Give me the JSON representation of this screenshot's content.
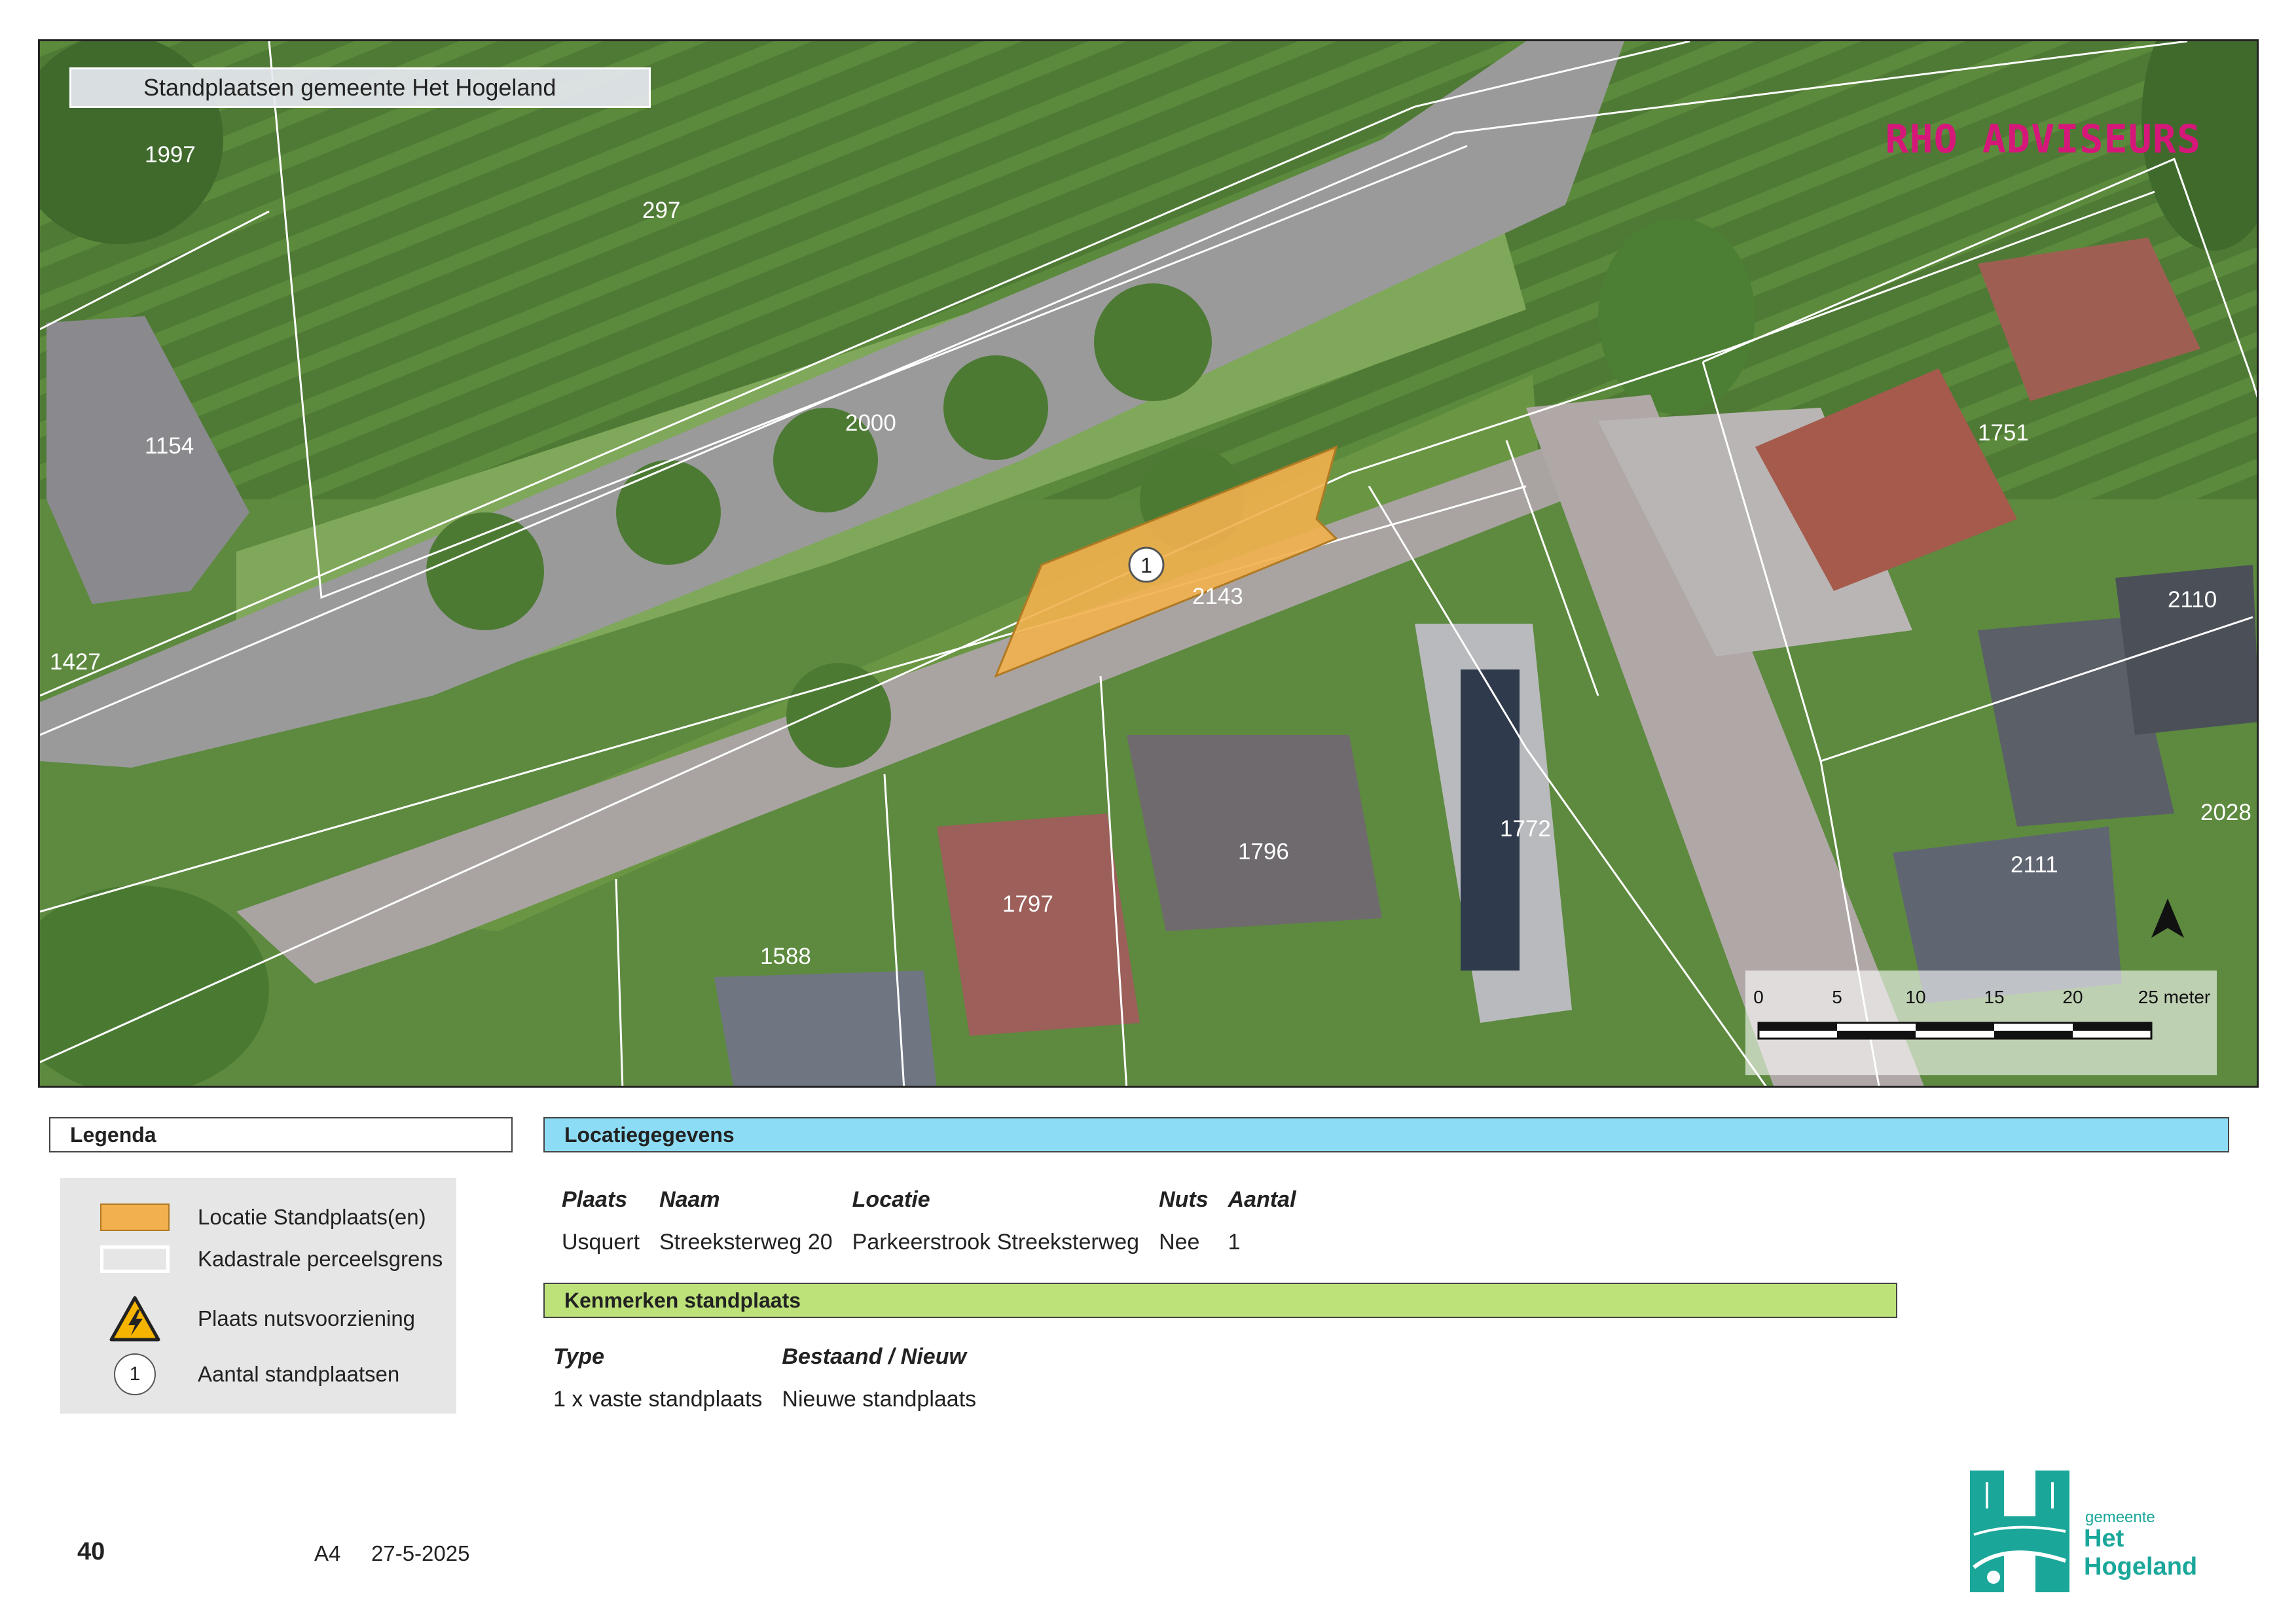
{
  "map": {
    "title": "Standplaatsen gemeente Het Hogeland",
    "brand": "RHO ADVISEURS",
    "parcels": [
      "1997",
      "297",
      "1154",
      "2000",
      "1427",
      "2143",
      "1751",
      "2110",
      "1772",
      "1796",
      "1797",
      "1588",
      "2111",
      "2028"
    ],
    "location_marker": "1",
    "north_arrow": "north-arrow-icon",
    "scale_bar": {
      "labels": [
        "0",
        "5",
        "10",
        "15",
        "20",
        "25 meter"
      ]
    },
    "colors": {
      "location_fill": "#f2b04e",
      "parcel_line": "#ffffff"
    }
  },
  "legend": {
    "title": "Legenda",
    "items": [
      {
        "label": "Locatie Standplaats(en)",
        "icon": "orange-area-swatch"
      },
      {
        "label": "Kadastrale perceelsgrens",
        "icon": "white-outline-swatch"
      },
      {
        "label": "Plaats nutsvoorziening",
        "icon": "electric-warning-icon"
      },
      {
        "label": "Aantal standplaatsen",
        "icon": "numbered-circle-icon",
        "symbol_text": "1"
      }
    ]
  },
  "location": {
    "title": "Locatiegegevens",
    "headers": [
      "Plaats",
      "Naam",
      "Locatie",
      "Nuts",
      "Aantal"
    ],
    "row": [
      "Usquert",
      "Streeksterweg 20",
      "Parkeerstrook Streeksterweg",
      "Nee",
      "1"
    ],
    "color": "#8ddcf5"
  },
  "features": {
    "title": "Kenmerken standplaats",
    "headers": [
      "Type",
      "Bestaand / Nieuw"
    ],
    "row": [
      "1 x vaste standplaats",
      "Nieuwe standplaats"
    ],
    "color": "#bde27a"
  },
  "footer": {
    "page_number": "40",
    "paper_size": "A4",
    "date": "27-5-2025",
    "logo_small": "gemeente",
    "logo_big": "Het Hogeland"
  }
}
